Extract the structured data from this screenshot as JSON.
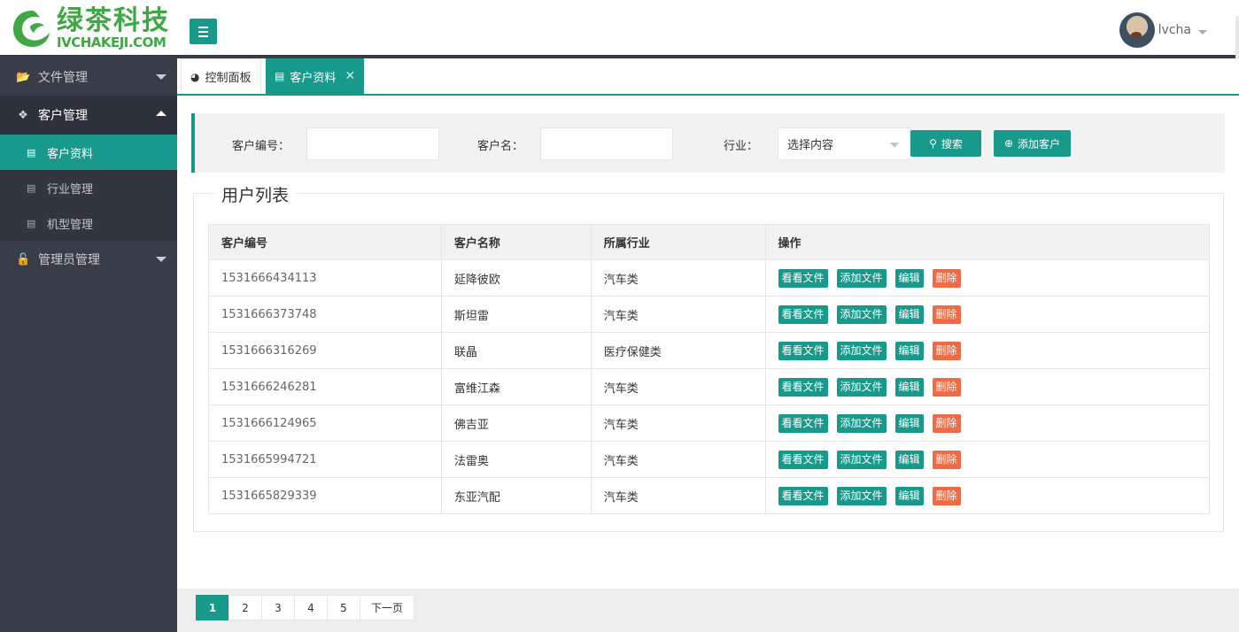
{
  "brand": {
    "name_cn": "绿茶科技",
    "name_en": "IVCHAKEJI.COM",
    "color": "#3fa845"
  },
  "header": {
    "username": "lvcha"
  },
  "sidebar": {
    "items": [
      {
        "label": "文件管理",
        "icon": "folder-icon"
      },
      {
        "label": "客户管理",
        "icon": "cubes-icon"
      },
      {
        "label": "管理员管理",
        "icon": "lock-icon"
      }
    ],
    "subitems": [
      {
        "label": "客户资料",
        "icon": "doc-icon"
      },
      {
        "label": "行业管理",
        "icon": "doc-icon"
      },
      {
        "label": "机型管理",
        "icon": "doc-icon"
      }
    ]
  },
  "tabs": [
    {
      "label": "控制面板",
      "icon": "dashboard-icon"
    },
    {
      "label": "客户资料",
      "icon": "doc-icon"
    }
  ],
  "search": {
    "id_label": "客户编号：",
    "name_label": "客户名：",
    "industry_label": "行业：",
    "industry_value": "选择内容",
    "search_button": "搜索",
    "add_button": "添加客户"
  },
  "list": {
    "title": "用户列表",
    "columns": [
      "客户编号",
      "客户名称",
      "所属行业",
      "操作"
    ],
    "rows": [
      {
        "id": "1531666434113",
        "name": "延降彼欧",
        "industry": "汽车类"
      },
      {
        "id": "1531666373748",
        "name": "斯坦雷",
        "industry": "汽车类"
      },
      {
        "id": "1531666316269",
        "name": "联晶",
        "industry": "医疗保健类"
      },
      {
        "id": "1531666246281",
        "name": "富维江森",
        "industry": "汽车类"
      },
      {
        "id": "1531666124965",
        "name": "佛吉亚",
        "industry": "汽车类"
      },
      {
        "id": "1531665994721",
        "name": "法雷奥",
        "industry": "汽车类"
      },
      {
        "id": "1531665829339",
        "name": "东亚汽配",
        "industry": "汽车类"
      }
    ],
    "actions": [
      "看看文件",
      "添加文件",
      "编辑",
      "删除"
    ]
  },
  "pager": {
    "pages": [
      "1",
      "2",
      "3",
      "4",
      "5"
    ],
    "next": "下一页",
    "current": "1"
  },
  "colors": {
    "accent": "#17998b",
    "sidebar": "#393D49",
    "danger": "#f06a45"
  }
}
